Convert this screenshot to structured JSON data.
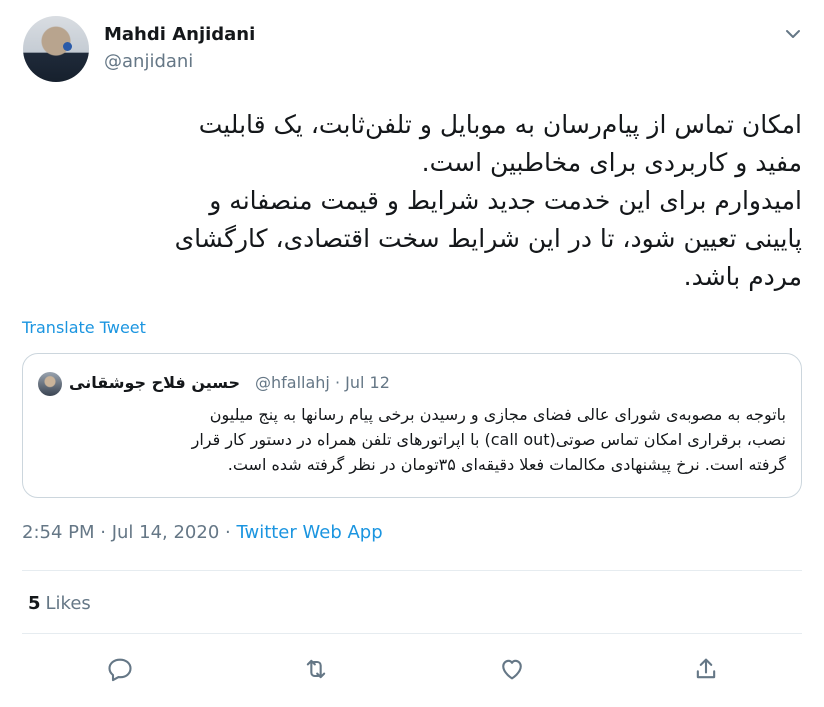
{
  "author": {
    "name": "Mahdi Anjidani",
    "handle": "@anjidani"
  },
  "tweet": {
    "lines": [
      "امکان تماس از پیام‌رسان به موبایل و تلفن‌ثابت، یک قابلیت",
      "مفید و کاربردی برای مخاطبین است.",
      "امیدوارم برای این خدمت جدید شرایط و قیمت منصفانه و",
      "پایینی تعیین شود، تا در این شرایط سخت اقتصادی، کارگشای",
      "مردم باشد."
    ],
    "translate_label": "Translate Tweet"
  },
  "quoted": {
    "name": "حسین فلاح جوشقانی",
    "meta": "@hfallahj · Jul 12",
    "lines": [
      "باتوجه به مصوبه‌ی شورای عالی فضای مجازی و رسیدن برخی پیام رسانها به پنج میلیون",
      "نصب، برقراری امکان تماس صوتی(call out) با اپراتورهای تلفن همراه در دستور کار قرار",
      "گرفته است. نرخ پیشنهادی مکالمات فعلا دقیقه‌ای ۳۵تومان در نظر گرفته شده است."
    ]
  },
  "timestamp": "2:54 PM · Jul 14, 2020 · ",
  "source": "Twitter Web App",
  "likes": {
    "count": "5",
    "label": "Likes"
  },
  "actions": {
    "reply": "reply-icon",
    "retweet": "retweet-icon",
    "like": "heart-icon",
    "share": "share-icon"
  },
  "colors": {
    "link": "#1b95e0",
    "secondary": "#657786",
    "text": "#14171a",
    "border": "#ccd6dd"
  }
}
